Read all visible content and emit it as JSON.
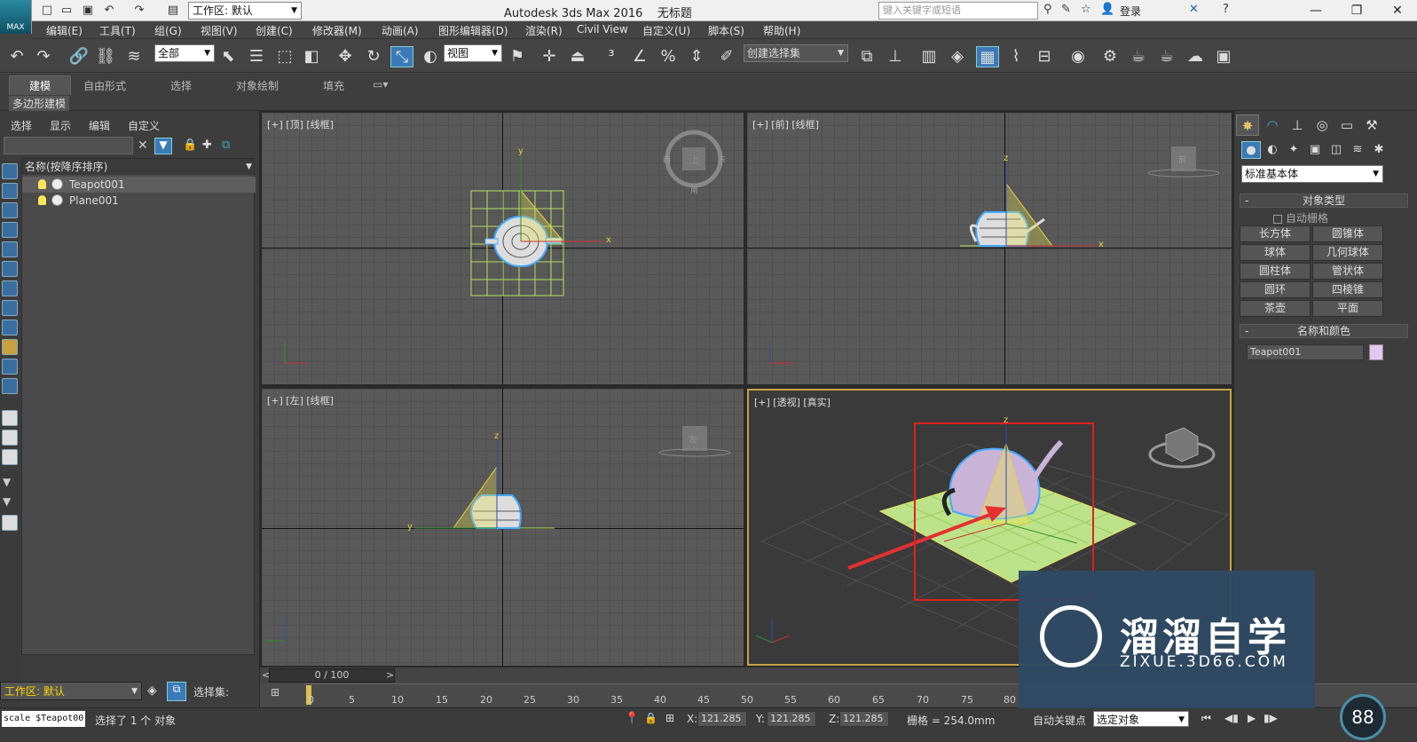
{
  "app": {
    "title": "Autodesk 3ds Max 2016",
    "doc": "无标题",
    "logo": "MAX"
  },
  "quick": {
    "workspace": "工作区: 默认",
    "search_placeholder": "键入关键字或短语",
    "login": "登录"
  },
  "window": {
    "min": "—",
    "max": "❐",
    "close": "✕"
  },
  "menus": [
    "编辑(E)",
    "工具(T)",
    "组(G)",
    "视图(V)",
    "创建(C)",
    "修改器(M)",
    "动画(A)",
    "图形编辑器(D)",
    "渲染(R)",
    "Civil View",
    "自定义(U)",
    "脚本(S)",
    "帮助(H)"
  ],
  "toolbar": {
    "filter": "全部",
    "refcoord": "视图",
    "selset": "创建选择集"
  },
  "ribbon": {
    "tabs": [
      "建模",
      "自由形式",
      "选择",
      "对象绘制",
      "填充"
    ],
    "subtitle": "多边形建模"
  },
  "scene": {
    "tabs": [
      "选择",
      "显示",
      "编辑",
      "自定义"
    ],
    "column": "名称(按降序排序)",
    "items": [
      "Teapot001",
      "Plane001"
    ],
    "workspace": "工作区: 默认",
    "selset": "选择集:"
  },
  "viewports": {
    "top": "[+] [顶] [线框]",
    "front": "[+] [前] [线框]",
    "left": "[+] [左] [线框]",
    "persp": "[+] [透视] [真实]",
    "cube_top": "上",
    "cube_front": "前",
    "cube_left": "左",
    "cube_w": "西",
    "cube_e": "东",
    "cube_s": "南"
  },
  "cmd": {
    "category": "标准基本体",
    "objtype_head": "对象类型",
    "autogrid": "自动栅格",
    "buttons": [
      "长方体",
      "圆锥体",
      "球体",
      "几何球体",
      "圆柱体",
      "管状体",
      "圆环",
      "四棱锥",
      "茶壶",
      "平面"
    ],
    "namecolor_head": "名称和颜色",
    "name": "Teapot001",
    "swatch_color": "#e2c8f0"
  },
  "time": {
    "slider": "0 / 100",
    "ticks": [
      "0",
      "5",
      "10",
      "15",
      "20",
      "25",
      "30",
      "35",
      "40",
      "45",
      "50",
      "55",
      "60",
      "65",
      "70",
      "75",
      "80"
    ]
  },
  "status": {
    "script": "scale $Teapot00",
    "message": "选择了 1 个 对象",
    "x": "121.285",
    "y": "121.285",
    "z": "121.285",
    "grid": "栅格 = 254.0mm",
    "autokey": "自动关键点",
    "selobj": "选定对象"
  },
  "watermark": {
    "brand": "溜溜自学",
    "url": "ZIXUE.3D66.COM"
  },
  "fps": "88"
}
